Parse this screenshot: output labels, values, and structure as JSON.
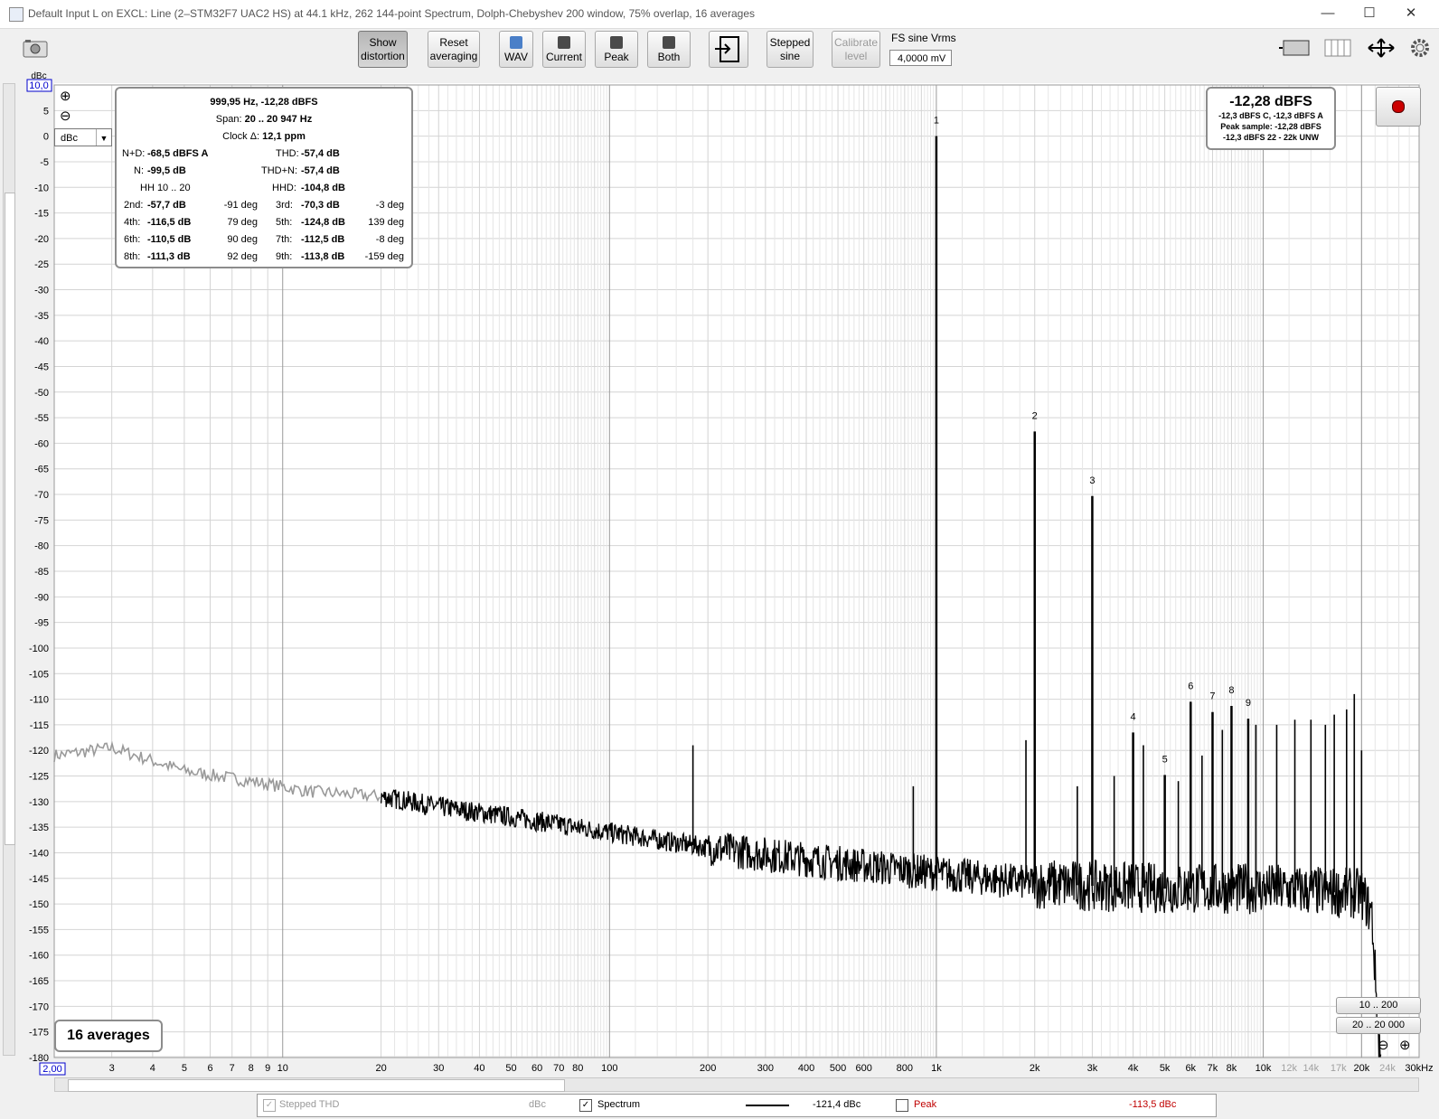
{
  "window": {
    "title": "Default Input L on EXCL: Line (2–STM32F7 UAC2 HS) at 44.1 kHz, 262 144-point Spectrum, Dolph-Chebyshev 200 window, 75% overlap, 16 averages"
  },
  "toolbar": {
    "show_distortion": [
      "Show",
      "distortion"
    ],
    "reset_averaging": [
      "Reset",
      "averaging"
    ],
    "wav": "WAV",
    "current": "Current",
    "peak": "Peak",
    "both": "Both",
    "stepped_sine": [
      "Stepped",
      "sine"
    ],
    "calibrate_level": [
      "Calibrate",
      "level"
    ],
    "fs_label": "FS sine Vrms",
    "fs_value": "4,0000 mV"
  },
  "distortion_panel": {
    "header": "999,95 Hz, -12,28 dBFS",
    "span_label": "Span:",
    "span_value": "20 .. 20 947 Hz",
    "clock_label": "Clock Δ:",
    "clock_value": "12,1 ppm",
    "nd_label": "N+D:",
    "nd_value": "-68,5 dBFS A",
    "thd_label": "THD:",
    "thd_value": "-57,4 dB",
    "n_label": "N:",
    "n_value": "-99,5 dB",
    "thdn_label": "THD+N:",
    "thdn_value": "-57,4 dB",
    "hh_label": "HH 10 .. 20",
    "hhd_label": "HHD:",
    "hhd_value": "-104,8 dB",
    "harmonics": [
      {
        "l1": "2nd:",
        "v1": "-57,7 dB",
        "d1": "-91 deg",
        "l2": "3rd:",
        "v2": "-70,3 dB",
        "d2": "-3 deg"
      },
      {
        "l1": "4th:",
        "v1": "-116,5 dB",
        "d1": "79 deg",
        "l2": "5th:",
        "v2": "-124,8 dB",
        "d2": "139 deg"
      },
      {
        "l1": "6th:",
        "v1": "-110,5 dB",
        "d1": "90 deg",
        "l2": "7th:",
        "v2": "-112,5 dB",
        "d2": "-8 deg"
      },
      {
        "l1": "8th:",
        "v1": "-111,3 dB",
        "d1": "92 deg",
        "l2": "9th:",
        "v2": "-113,8 dB",
        "d2": "-159 deg"
      }
    ]
  },
  "level_panel": {
    "big": "-12,28 dBFS",
    "line1": "-12,3 dBFS C, -12,3 dBFS A",
    "line2": "Peak sample: -12,28 dBFS",
    "line3": "-12,3 dBFS 22 - 22k UNW"
  },
  "y_axis": {
    "unit": "dBc",
    "top_value": "10,0",
    "selector": "dBc"
  },
  "x_axis": {
    "left_value": "2,00"
  },
  "averages_label": "16 averages",
  "zoom_buttons": [
    "10 .. 200",
    "20 .. 20 000"
  ],
  "legend": {
    "stepped_thd": "Stepped THD",
    "stepped_unit": "dBc",
    "spectrum": "Spectrum",
    "spectrum_value": "-121,4 dBc",
    "peak": "Peak",
    "peak_value": "-113,5 dBc",
    "peak_color": "#c00000"
  },
  "chart_data": {
    "type": "line",
    "title": "",
    "xlabel": "",
    "ylabel": "dBc",
    "x_scale": "log",
    "xlim": [
      2,
      30000
    ],
    "ylim": [
      -180,
      10
    ],
    "grid": true,
    "y_ticks": [
      10,
      5,
      0,
      -5,
      -10,
      -15,
      -20,
      -25,
      -30,
      -35,
      -40,
      -45,
      -50,
      -55,
      -60,
      -65,
      -70,
      -75,
      -80,
      -85,
      -90,
      -95,
      -100,
      -105,
      -110,
      -115,
      -120,
      -125,
      -130,
      -135,
      -140,
      -145,
      -150,
      -155,
      -160,
      -165,
      -170,
      -175,
      -180
    ],
    "x_tick_labels": [
      {
        "x": 2,
        "label": "2,00"
      },
      {
        "x": 3,
        "label": "3"
      },
      {
        "x": 4,
        "label": "4"
      },
      {
        "x": 5,
        "label": "5"
      },
      {
        "x": 6,
        "label": "6"
      },
      {
        "x": 7,
        "label": "7"
      },
      {
        "x": 8,
        "label": "8"
      },
      {
        "x": 9,
        "label": "9"
      },
      {
        "x": 10,
        "label": "10"
      },
      {
        "x": 20,
        "label": "20"
      },
      {
        "x": 30,
        "label": "30"
      },
      {
        "x": 40,
        "label": "40"
      },
      {
        "x": 50,
        "label": "50"
      },
      {
        "x": 60,
        "label": "60"
      },
      {
        "x": 70,
        "label": "70"
      },
      {
        "x": 80,
        "label": "80"
      },
      {
        "x": 100,
        "label": "100"
      },
      {
        "x": 200,
        "label": "200"
      },
      {
        "x": 300,
        "label": "300"
      },
      {
        "x": 400,
        "label": "400"
      },
      {
        "x": 500,
        "label": "500"
      },
      {
        "x": 600,
        "label": "600"
      },
      {
        "x": 800,
        "label": "800"
      },
      {
        "x": 1000,
        "label": "1k"
      },
      {
        "x": 2000,
        "label": "2k"
      },
      {
        "x": 3000,
        "label": "3k"
      },
      {
        "x": 4000,
        "label": "4k"
      },
      {
        "x": 5000,
        "label": "5k"
      },
      {
        "x": 6000,
        "label": "6k"
      },
      {
        "x": 7000,
        "label": "7k"
      },
      {
        "x": 8000,
        "label": "8k"
      },
      {
        "x": 10000,
        "label": "10k"
      },
      {
        "x": 12000,
        "label": "12k",
        "grey": true
      },
      {
        "x": 14000,
        "label": "14k",
        "grey": true
      },
      {
        "x": 17000,
        "label": "17k",
        "grey": true
      },
      {
        "x": 20000,
        "label": "20k"
      },
      {
        "x": 24000,
        "label": "24k",
        "grey": true
      },
      {
        "x": 30000,
        "label": "30kHz"
      }
    ],
    "series": [
      {
        "name": "Spectrum",
        "floor": [
          [
            2,
            -121
          ],
          [
            3,
            -119.5
          ],
          [
            5,
            -124
          ],
          [
            8,
            -126
          ],
          [
            12,
            -128
          ],
          [
            20,
            -129
          ],
          [
            30,
            -131
          ],
          [
            50,
            -133
          ],
          [
            100,
            -136
          ],
          [
            200,
            -139
          ],
          [
            500,
            -142
          ],
          [
            1000,
            -144
          ],
          [
            2000,
            -146
          ],
          [
            5000,
            -147
          ],
          [
            10000,
            -147
          ],
          [
            20000,
            -148
          ],
          [
            21500,
            -152
          ],
          [
            22500,
            -175
          ],
          [
            23000,
            -182
          ]
        ],
        "harmonic_markers": [
          {
            "label": "1",
            "x": 1000,
            "y": 0
          },
          {
            "label": "2",
            "x": 2000,
            "y": -57.7
          },
          {
            "label": "3",
            "x": 3000,
            "y": -70.3
          },
          {
            "label": "4",
            "x": 4000,
            "y": -116.5
          },
          {
            "label": "5",
            "x": 5000,
            "y": -124.8
          },
          {
            "label": "6",
            "x": 6000,
            "y": -110.5
          },
          {
            "label": "7",
            "x": 7000,
            "y": -112.5
          },
          {
            "label": "8",
            "x": 8000,
            "y": -111.3
          },
          {
            "label": "9",
            "x": 9000,
            "y": -113.8
          }
        ],
        "spurs": [
          [
            180,
            -119
          ],
          [
            850,
            -127
          ],
          [
            1880,
            -118
          ],
          [
            2700,
            -127
          ],
          [
            3500,
            -125
          ],
          [
            4300,
            -119
          ],
          [
            5500,
            -126
          ],
          [
            6500,
            -121
          ],
          [
            7500,
            -116
          ],
          [
            9500,
            -115
          ],
          [
            11000,
            -115
          ],
          [
            12500,
            -114
          ],
          [
            14000,
            -114
          ],
          [
            15500,
            -115
          ],
          [
            16500,
            -113
          ],
          [
            18000,
            -112
          ],
          [
            19000,
            -109
          ],
          [
            20000,
            -120
          ]
        ]
      }
    ]
  }
}
